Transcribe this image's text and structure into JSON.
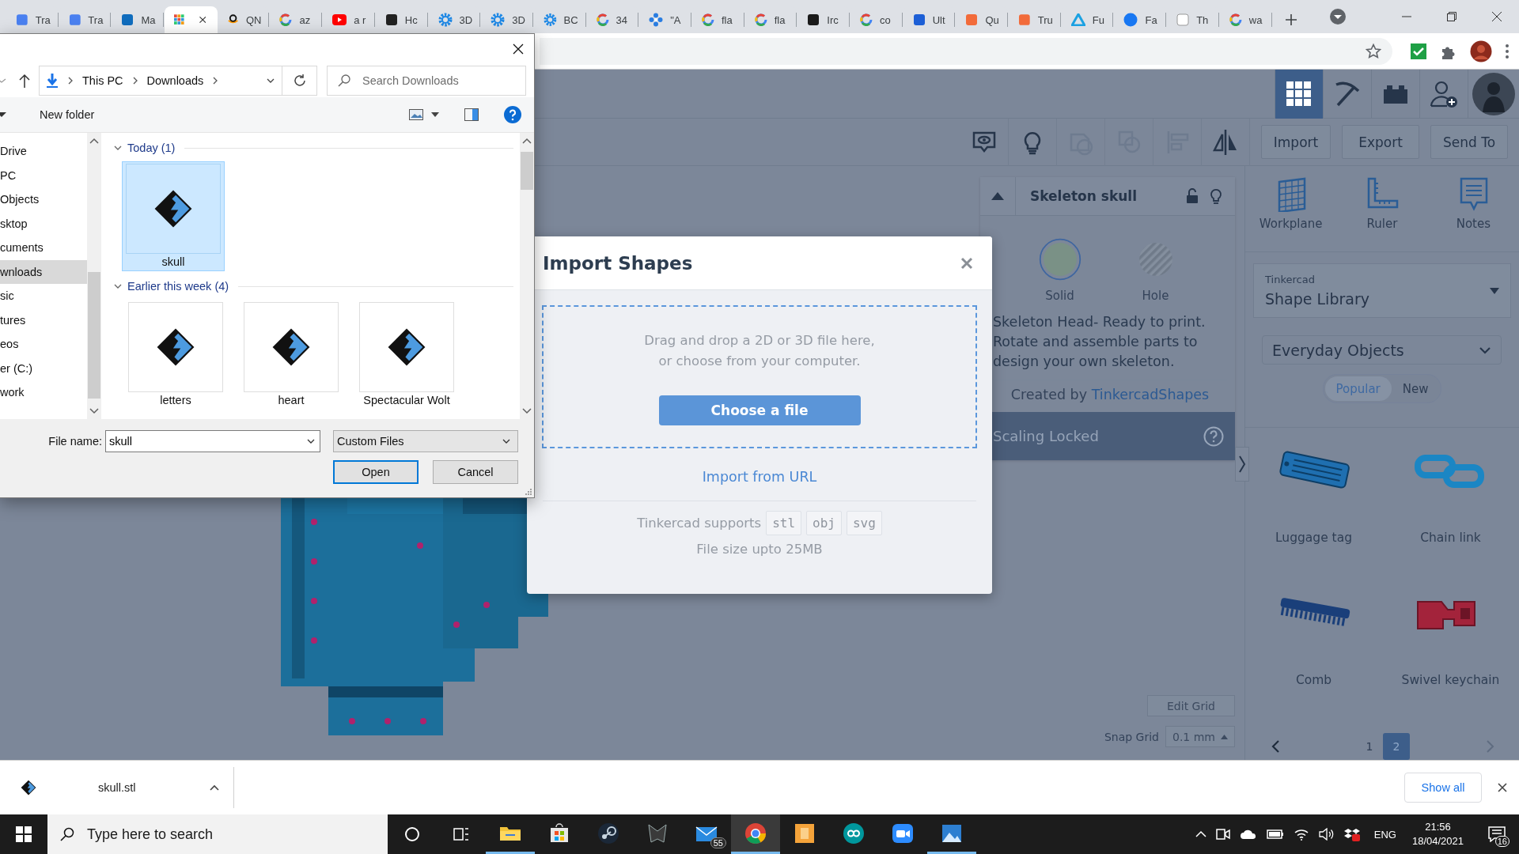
{
  "browser": {
    "tabs": [
      {
        "label": "Tra",
        "selected": false
      },
      {
        "label": "Tra",
        "selected": false
      },
      {
        "label": "Ma",
        "selected": false
      },
      {
        "selected": true
      },
      {
        "label": "QN",
        "selected": false
      },
      {
        "label": "az",
        "selected": false
      },
      {
        "label": "a r",
        "selected": false
      },
      {
        "label": "Hc",
        "selected": false
      },
      {
        "label": "3D",
        "selected": false
      },
      {
        "label": "3D",
        "selected": false
      },
      {
        "label": "BC",
        "selected": false
      },
      {
        "label": "34",
        "selected": false
      },
      {
        "label": "\"A",
        "selected": false
      },
      {
        "label": "fla",
        "selected": false
      },
      {
        "label": "fla",
        "selected": false
      },
      {
        "label": "Irc",
        "selected": false
      },
      {
        "label": "co",
        "selected": false
      },
      {
        "label": "Ult",
        "selected": false
      },
      {
        "label": "Qu",
        "selected": false
      },
      {
        "label": "Tru",
        "selected": false
      },
      {
        "label": "Fu",
        "selected": false
      },
      {
        "label": "Fa",
        "selected": false
      },
      {
        "label": "Th",
        "selected": false
      },
      {
        "label": "wa",
        "selected": false
      }
    ]
  },
  "file_dialog": {
    "breadcrumb": [
      "This PC",
      "Downloads"
    ],
    "search": {
      "placeholder": "Search Downloads"
    },
    "new_folder": "New folder",
    "nav_items": [
      {
        "label": "Drive",
        "selected": false
      },
      {
        "label": "PC",
        "selected": false
      },
      {
        "label": "Objects",
        "selected": false
      },
      {
        "label": "sktop",
        "selected": false
      },
      {
        "label": "cuments",
        "selected": false
      },
      {
        "label": "wnloads",
        "selected": true
      },
      {
        "label": "sic",
        "selected": false
      },
      {
        "label": "tures",
        "selected": false
      },
      {
        "label": "eos",
        "selected": false
      },
      {
        "label": "er (C:)",
        "selected": false
      },
      {
        "label": "work",
        "selected": false
      }
    ],
    "groups": [
      {
        "title": "Today (1)",
        "expanded": true,
        "files": [
          {
            "name": "skull",
            "selected": true
          }
        ]
      },
      {
        "title": "Earlier this week (4)",
        "expanded": true,
        "files": [
          {
            "name": "letters",
            "selected": false
          },
          {
            "name": "heart",
            "selected": false
          },
          {
            "name": "Spectacular Wolt",
            "selected": false
          }
        ]
      }
    ],
    "file_name_label": "File name:",
    "file_name": "skull",
    "file_type": "Custom Files",
    "buttons": [
      {
        "label": "Open",
        "default": true
      },
      {
        "label": "Cancel",
        "default": false
      }
    ]
  },
  "tinkercad": {
    "nav": [
      {
        "selected": true
      },
      {
        "selected": false
      },
      {
        "selected": false
      }
    ],
    "tool_buttons": [
      {
        "disabled": false
      },
      {
        "disabled": false
      },
      {
        "disabled": true
      },
      {
        "disabled": true
      },
      {
        "disabled": true
      },
      {
        "disabled": false
      }
    ],
    "actions": [
      "Import",
      "Export",
      "Send To"
    ],
    "inspector": {
      "title": "Skeleton skull",
      "types": [
        {
          "label": "Solid",
          "selected": true
        },
        {
          "label": "Hole",
          "selected": false
        }
      ],
      "description": "Skeleton Head- Ready to print. Rotate and assemble parts to design your own skeleton.",
      "credit": "Created by",
      "author": "TinkercadShapes",
      "scaling": "Scaling Locked"
    },
    "tools": [
      "Workplane",
      "Ruler",
      "Notes"
    ],
    "library": {
      "caption": "Tinkercad",
      "title": "Shape Library"
    },
    "category": "Everyday Objects",
    "filters": [
      {
        "label": "Popular",
        "selected": true
      },
      {
        "label": "New",
        "selected": false
      }
    ],
    "shapes": [
      {
        "label": "Luggage tag",
        "kind": "tag"
      },
      {
        "label": "Chain link",
        "kind": "chain"
      },
      {
        "label": "Comb",
        "kind": "comb"
      },
      {
        "label": "Swivel keychain",
        "kind": "keychain"
      }
    ],
    "pages": [
      {
        "label": "1",
        "selected": false
      },
      {
        "label": "2",
        "selected": true
      }
    ],
    "edit_grid": "Edit Grid",
    "snap_grid": {
      "label": "Snap Grid",
      "value": "0.1 mm"
    }
  },
  "import_modal": {
    "title": "Import Shapes",
    "hint": "Drag and drop a 2D or 3D file here,\nor choose from your computer.",
    "button": "Choose a file",
    "url_link": "Import from URL",
    "supports": "Tinkercad supports",
    "formats": [
      "stl",
      "obj",
      "svg"
    ],
    "size_note": "File size upto 25MB"
  },
  "download_bar": {
    "file": "skull.stl",
    "show_all": "Show all"
  },
  "taskbar": {
    "search": {
      "placeholder": "Type here to search"
    },
    "apps": [
      {
        "kind": "explorer",
        "open": true,
        "selected": false
      },
      {
        "kind": "store",
        "open": false,
        "selected": false
      },
      {
        "kind": "steam",
        "open": false,
        "selected": false
      },
      {
        "kind": "predator",
        "open": false,
        "selected": false
      },
      {
        "kind": "mail",
        "open": false,
        "selected": false,
        "badge": "55"
      },
      {
        "kind": "chrome",
        "open": true,
        "selected": true
      },
      {
        "kind": "fusion",
        "open": false,
        "selected": false
      },
      {
        "kind": "arduino",
        "open": false,
        "selected": false
      },
      {
        "kind": "zoom",
        "open": false,
        "selected": false
      },
      {
        "kind": "photos",
        "open": true,
        "selected": false
      }
    ],
    "language": "ENG",
    "time": "21:56",
    "date": "18/04/2021",
    "notifications": "16"
  }
}
